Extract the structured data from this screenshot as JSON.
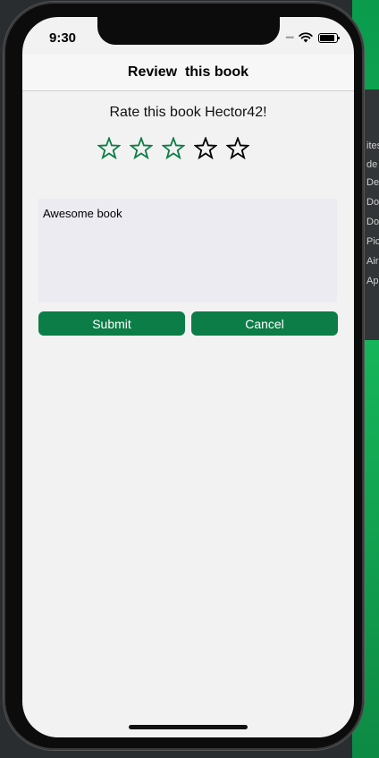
{
  "status_bar": {
    "time": "9:30",
    "signal_icon": "signal-dots-icon",
    "wifi_icon": "wifi-icon",
    "battery_icon": "battery-icon"
  },
  "navbar": {
    "title": "Review  this book"
  },
  "rating": {
    "prompt": "Rate this book Hector42!",
    "max": 5,
    "value": 3,
    "filled_color": "#0d7d47",
    "empty_color": "#000000"
  },
  "review": {
    "text": "Awesome book"
  },
  "buttons": {
    "submit_label": "Submit",
    "cancel_label": "Cancel",
    "color": "#0d7d47"
  },
  "background_menu": [
    "ites",
    "de",
    "De",
    "Do",
    "Do",
    "Pic",
    "Air",
    "Ap"
  ]
}
